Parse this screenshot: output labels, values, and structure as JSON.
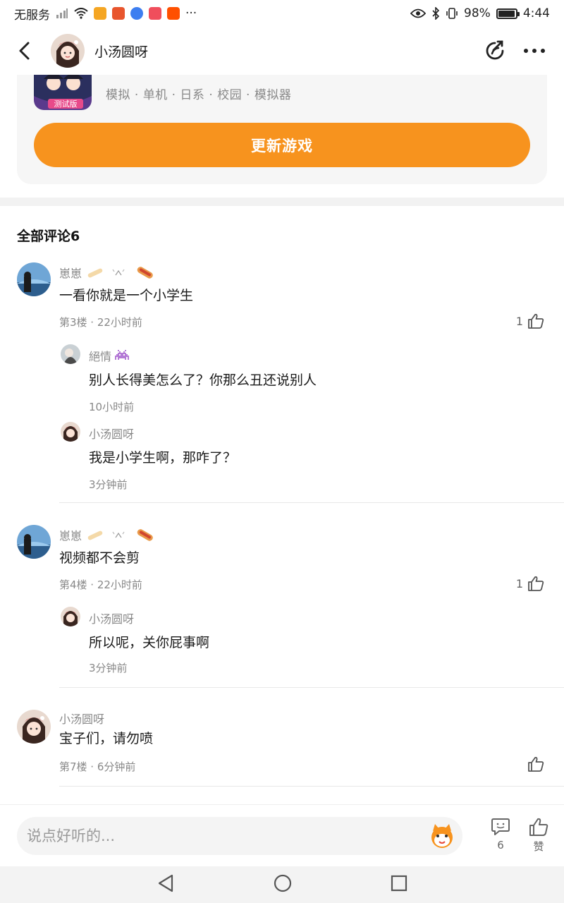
{
  "status_bar": {
    "carrier": "无服务",
    "battery": "98%",
    "time": "4:44",
    "battery_level": 0.98,
    "more": "···"
  },
  "header": {
    "username": "小汤圆呀",
    "icons": [
      "back-arrow-icon",
      "share-icon",
      "more-icon"
    ]
  },
  "game_card": {
    "tags": "模拟 · 单机 · 日系 · 校园 · 模拟器",
    "icon_badge": "测试版",
    "update_button": "更新游戏"
  },
  "comments_section": {
    "title": "全部评论6"
  },
  "comments": [
    {
      "username": "崽崽",
      "text": "一看你就是一个小学生",
      "meta": "第3楼 · 22小时前",
      "likes": "1",
      "replies": [
        {
          "username": "絕情",
          "text": "别人长得美怎么了？你那么丑还说别人",
          "meta": "10小时前"
        },
        {
          "username": "小汤圆呀",
          "text": "我是小学生啊，那咋了？",
          "meta": "3分钟前"
        }
      ]
    },
    {
      "username": "崽崽",
      "text": "视频都不会剪",
      "meta": "第4楼 · 22小时前",
      "likes": "1",
      "replies": [
        {
          "username": "小汤圆呀",
          "text": "所以呢，关你屁事啊",
          "meta": "3分钟前"
        }
      ]
    },
    {
      "username": "小汤圆呀",
      "text": "宝子们，请勿喷",
      "meta": "第7楼 · 6分钟前",
      "likes": ""
    }
  ],
  "bottom_bar": {
    "placeholder": "说点好听的...",
    "comment_count": "6",
    "like_label": "赞"
  },
  "colors": {
    "accent": "#f7931e",
    "text_primary": "#1a1a1a",
    "text_secondary": "#888888"
  }
}
